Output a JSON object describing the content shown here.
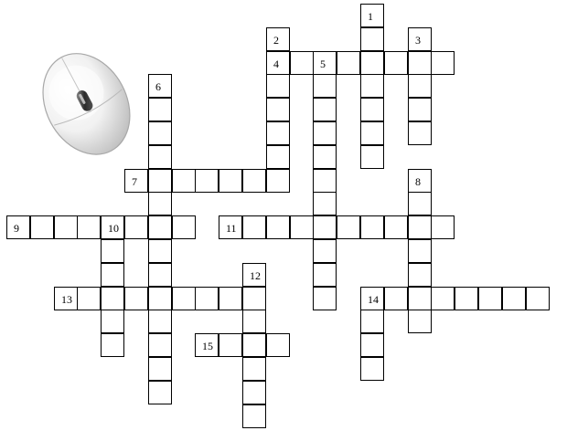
{
  "colors": {
    "border": "#000000",
    "cell_bg": "#ffffff",
    "page_bg": "#ffffff"
  },
  "illustration": {
    "icon": "computer-mouse-icon"
  },
  "crossword": {
    "clues": [
      {
        "number": "1",
        "direction": "down",
        "length": 7
      },
      {
        "number": "2",
        "direction": "down",
        "length": 7
      },
      {
        "number": "3",
        "direction": "down",
        "length": 5
      },
      {
        "number": "4",
        "direction": "across",
        "length": 8
      },
      {
        "number": "5",
        "direction": "down",
        "length": 11
      },
      {
        "number": "6",
        "direction": "down",
        "length": 14
      },
      {
        "number": "7",
        "direction": "across",
        "length": 7
      },
      {
        "number": "8",
        "direction": "down",
        "length": 7
      },
      {
        "number": "9",
        "direction": "across",
        "length": 8
      },
      {
        "number": "10",
        "direction": "down",
        "length": 6
      },
      {
        "number": "11",
        "direction": "across",
        "length": 10
      },
      {
        "number": "12",
        "direction": "down",
        "length": 7
      },
      {
        "number": "13",
        "direction": "across",
        "length": 9
      },
      {
        "number": "14",
        "direction": "across",
        "length": 8
      },
      {
        "number": "14",
        "direction": "down",
        "length": 4
      },
      {
        "number": "15",
        "direction": "across",
        "length": 4
      }
    ]
  }
}
